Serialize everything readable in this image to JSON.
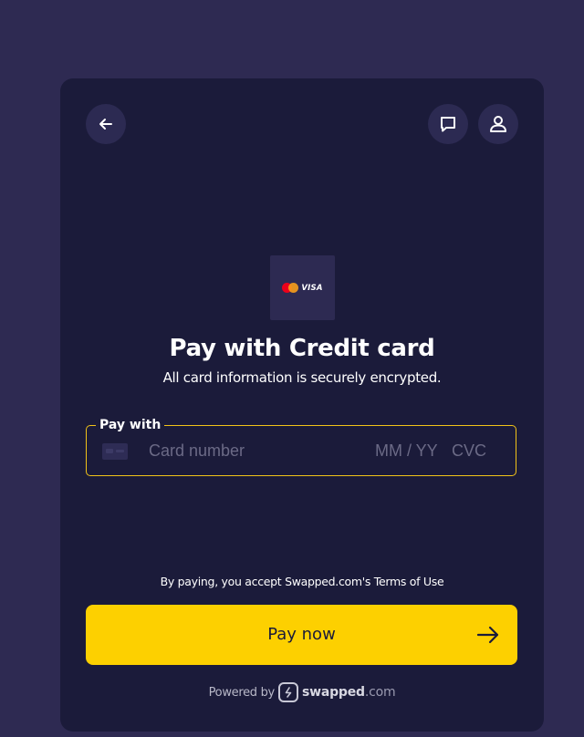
{
  "header": {
    "back_icon": "arrow-left-icon",
    "chat_icon": "chat-bubble-icon",
    "user_icon": "user-icon"
  },
  "payment_method": {
    "badge_brands": [
      "mastercard",
      "visa"
    ],
    "visa_text": "VISA",
    "title": "Pay with Credit card",
    "subtitle": "All card information is securely encrypted."
  },
  "card_field": {
    "legend": "Pay with",
    "card_number_placeholder": "Card number",
    "expiry_placeholder": "MM / YY",
    "cvc_placeholder": "CVC",
    "accent_color": "#f2c318"
  },
  "footer": {
    "terms_text": "By paying, you accept Swapped.com's Terms of Use",
    "pay_button_label": "Pay now",
    "pay_button_color": "#fdd000",
    "powered_by_label": "Powered by",
    "brand_bold": "swapped",
    "brand_suffix": ".com"
  },
  "colors": {
    "page_bg": "#2e2a52",
    "panel_bg": "#1b1b3a"
  }
}
